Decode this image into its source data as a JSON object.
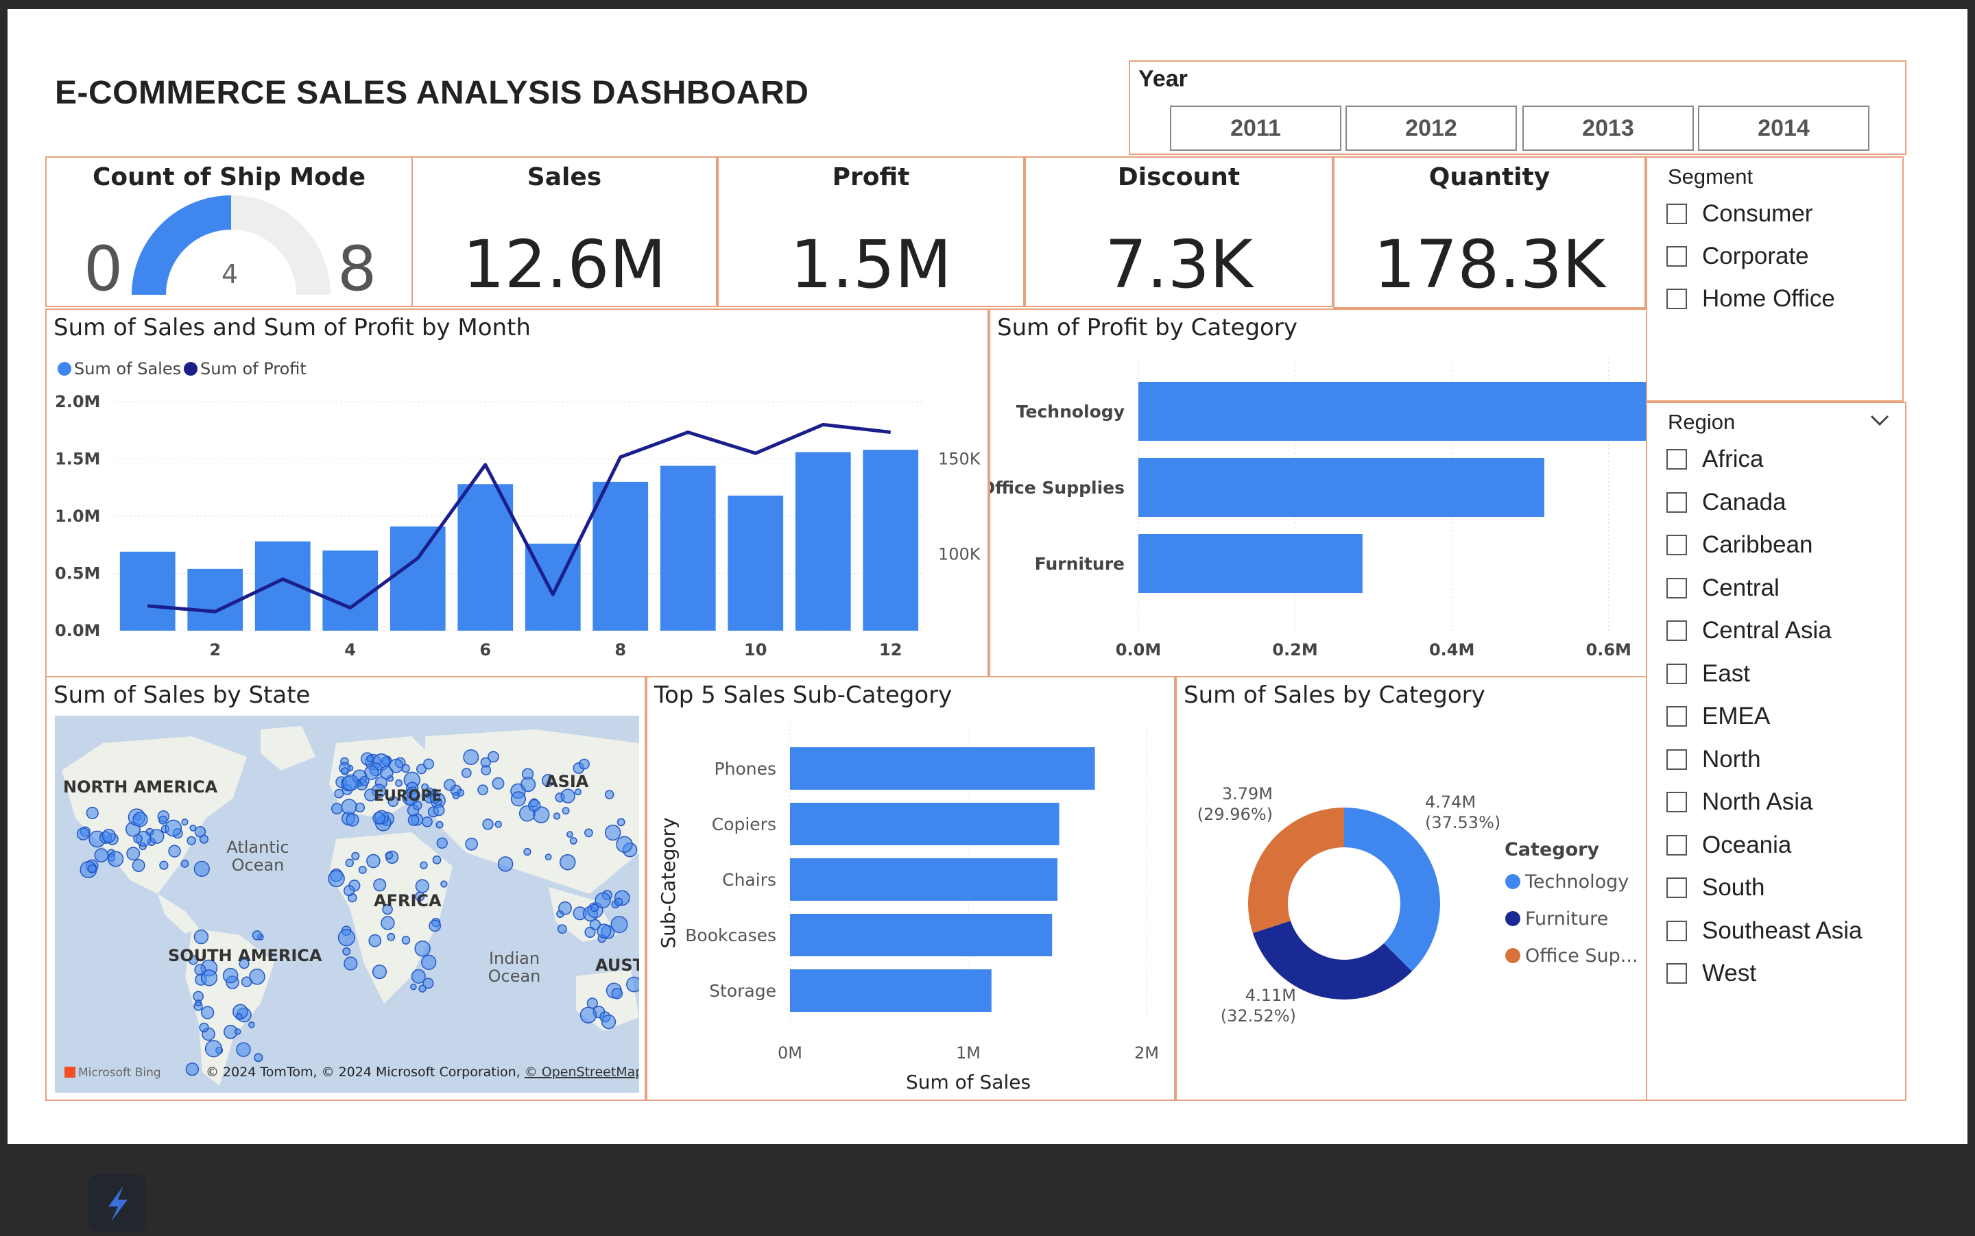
{
  "dashboard": {
    "title": "E-COMMERCE SALES ANALYSIS DASHBOARD"
  },
  "year_slicer": {
    "label": "Year",
    "options": [
      "2011",
      "2012",
      "2013",
      "2014"
    ]
  },
  "ship_mode_card": {
    "title": "Count of Ship Mode",
    "min": "0",
    "max": "8",
    "value": "4",
    "fraction": 0.5
  },
  "kpis": [
    {
      "title": "Sales",
      "value": "12.6M"
    },
    {
      "title": "Profit",
      "value": "1.5M"
    },
    {
      "title": "Discount",
      "value": "7.3K"
    },
    {
      "title": "Quantity",
      "value": "178.3K"
    }
  ],
  "segment_slicer": {
    "label": "Segment",
    "items": [
      "Consumer",
      "Corporate",
      "Home Office"
    ]
  },
  "region_slicer": {
    "label": "Region",
    "items": [
      "Africa",
      "Canada",
      "Caribbean",
      "Central",
      "Central Asia",
      "East",
      "EMEA",
      "North",
      "North Asia",
      "Oceania",
      "South",
      "Southeast Asia",
      "West"
    ]
  },
  "map": {
    "title": "Sum of Sales by State",
    "labels": {
      "north_america": "NORTH AMERICA",
      "europe": "EUROPE",
      "asia": "ASIA",
      "atlantic": "Atlantic Ocean",
      "africa": "AFRICA",
      "south_america": "SOUTH AMERICA",
      "indian": "Indian Ocean",
      "australia": "AUST"
    },
    "logo": "Microsoft Bing",
    "attribution": "© 2024 TomTom, © 2024 Microsoft Corporation,",
    "attribution_link": "© OpenStreetMap"
  },
  "colors": {
    "sales": "#3f86ef",
    "profit": "#1a1f8c",
    "technology": "#3f86ef",
    "furniture": "#1a2a94",
    "office": "#d9713b",
    "border": "#e9a07c"
  },
  "chart_data": [
    {
      "type": "bar",
      "title": "Sum of Sales and Sum of Profit by Month",
      "legend": [
        "Sum of Sales",
        "Sum of Profit"
      ],
      "categories": [
        1,
        2,
        3,
        4,
        5,
        6,
        7,
        8,
        9,
        10,
        11,
        12
      ],
      "x_ticks": [
        "2",
        "4",
        "6",
        "8",
        "10",
        "12"
      ],
      "y_ticks": [
        "0.0M",
        "0.5M",
        "1.0M",
        "1.5M",
        "2.0M"
      ],
      "y2_ticks": [
        "100K",
        "150K"
      ],
      "ylim": [
        0,
        2000000
      ],
      "y2lim": [
        60000,
        180000
      ],
      "series": [
        {
          "name": "Sum of Sales",
          "type": "bar",
          "values": [
            690000,
            540000,
            780000,
            700000,
            910000,
            1280000,
            760000,
            1300000,
            1440000,
            1180000,
            1560000,
            1580000
          ]
        },
        {
          "name": "Sum of Profit",
          "type": "line",
          "values": [
            73000,
            70000,
            87000,
            72000,
            98000,
            147000,
            79000,
            151000,
            164000,
            153000,
            168000,
            164000
          ]
        }
      ]
    },
    {
      "type": "bar",
      "orientation": "horizontal",
      "title": "Sum of Profit by Category",
      "categories": [
        "Technology",
        "Office Supplies",
        "Furniture"
      ],
      "values": [
        663000,
        518000,
        286000
      ],
      "x_ticks": [
        "0.0M",
        "0.2M",
        "0.4M",
        "0.6M"
      ],
      "xlim": [
        0,
        700000
      ]
    },
    {
      "type": "bar",
      "orientation": "horizontal",
      "title": "Top 5 Sales Sub-Category",
      "categories": [
        "Phones",
        "Copiers",
        "Chairs",
        "Bookcases",
        "Storage"
      ],
      "values": [
        1710000,
        1510000,
        1500000,
        1470000,
        1130000
      ],
      "x_ticks": [
        "0M",
        "1M",
        "2M"
      ],
      "xlim": [
        0,
        2000000
      ],
      "xlabel": "Sum of Sales",
      "ylabel": "Sub-Category"
    },
    {
      "type": "pie",
      "title": "Sum of Sales by Category",
      "legend_title": "Category",
      "categories": [
        "Technology",
        "Furniture",
        "Office Sup..."
      ],
      "values": [
        4.74,
        4.11,
        3.79
      ],
      "labels": [
        "4.74M",
        "4.11M",
        "3.79M"
      ],
      "percents": [
        "(37.53%)",
        "(32.52%)",
        "(29.96%)"
      ]
    }
  ]
}
